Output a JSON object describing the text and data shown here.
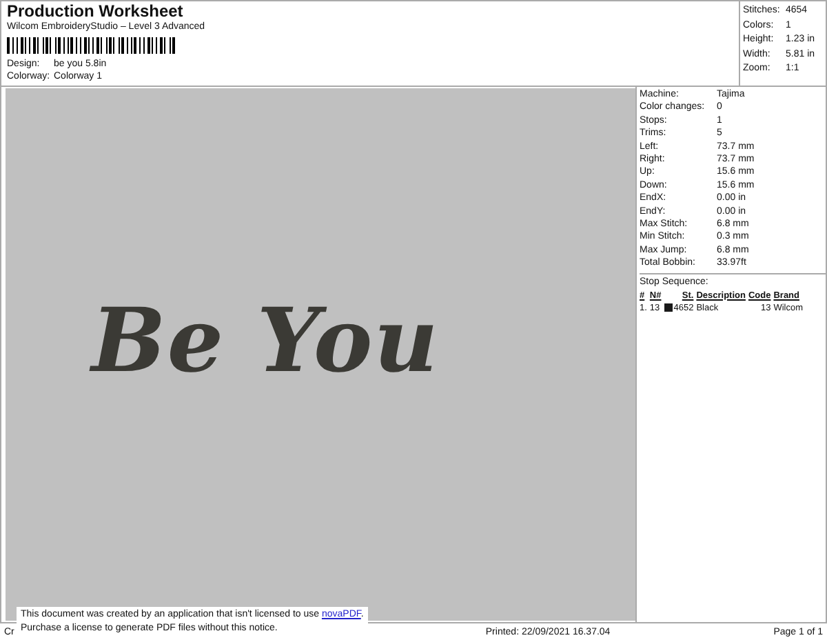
{
  "header": {
    "title": "Production Worksheet",
    "subtitle": "Wilcom EmbroideryStudio – Level 3 Advanced",
    "fields": [
      {
        "label": "Design:",
        "value": "be you 5.8in"
      },
      {
        "label": "Colorway:",
        "value": "Colorway 1"
      }
    ]
  },
  "summary": [
    {
      "label": "Stitches:",
      "value": "4654"
    },
    {
      "label": "Colors:",
      "value": "1"
    },
    {
      "label": "Height:",
      "value": "1.23 in"
    },
    {
      "label": "Width:",
      "value": "5.81 in"
    },
    {
      "label": "Zoom:",
      "value": "1:1"
    }
  ],
  "design_preview": {
    "text": "Be You"
  },
  "details": [
    {
      "label": "Machine:",
      "value": "Tajima"
    },
    {
      "label": "Color changes:",
      "value": "0"
    },
    {
      "label": "Stops:",
      "value": "1"
    },
    {
      "label": "Trims:",
      "value": "5"
    },
    {
      "label": "Left:",
      "value": "73.7 mm"
    },
    {
      "label": "Right:",
      "value": "73.7 mm"
    },
    {
      "label": "Up:",
      "value": "15.6 mm"
    },
    {
      "label": "Down:",
      "value": "15.6 mm"
    },
    {
      "label": "EndX:",
      "value": "0.00 in"
    },
    {
      "label": "EndY:",
      "value": "0.00 in"
    },
    {
      "label": "Max Stitch:",
      "value": "6.8 mm"
    },
    {
      "label": "Min Stitch:",
      "value": "0.3 mm"
    },
    {
      "label": "Max Jump:",
      "value": "6.8 mm"
    },
    {
      "label": "Total Bobbin:",
      "value": "33.97ft"
    }
  ],
  "stop_sequence": {
    "title": "Stop Sequence:",
    "columns": [
      "#",
      "N#",
      "St.",
      "Description",
      "Code",
      "Brand"
    ],
    "rows": [
      {
        "index": "1.",
        "needle": "13",
        "color": "#1a1a1a",
        "stitches": "4652",
        "description": "Black",
        "code": "13",
        "brand": "Wilcom"
      }
    ]
  },
  "footer": {
    "left": "Cr",
    "printed": "Printed: 22/09/2021 16.37.04",
    "page": "Page 1 of 1"
  },
  "notice": {
    "line1": "This document was created by an application that isn't licensed to use ",
    "link": "novaPDF",
    "line1_end": ".",
    "line2": "Purchase a license to generate PDF files without this notice."
  }
}
